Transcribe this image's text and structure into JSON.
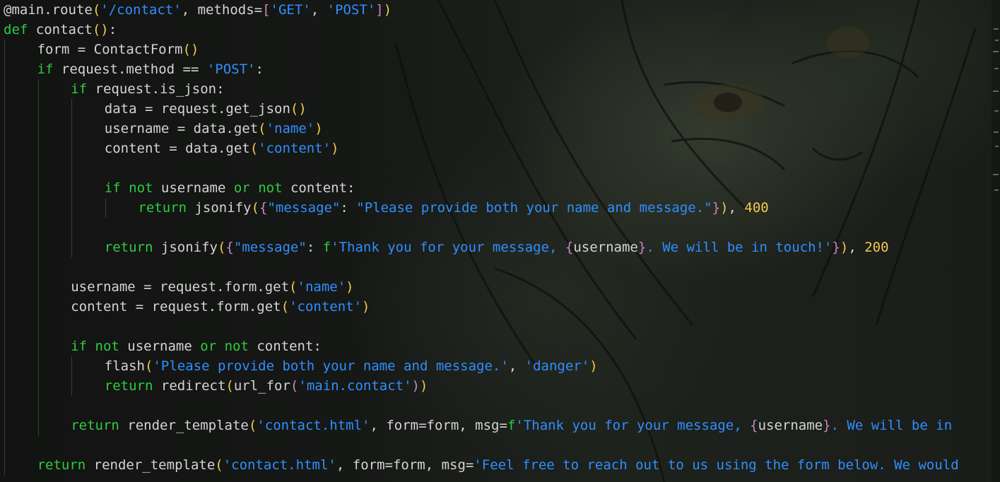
{
  "editor": {
    "language": "python",
    "token_colors": {
      "keyword": "#2ecc40",
      "string": "#2f8fff",
      "number": "#f2c94c",
      "text": "#d4d4d4",
      "bracket_level1": "#f2c94c",
      "bracket_level2": "#c586c0",
      "bracket_level3": "#2f8fff"
    },
    "lines": [
      {
        "indent": 0,
        "tokens": [
          {
            "t": "@main.route",
            "c": "deco"
          },
          {
            "t": "(",
            "c": "p1"
          },
          {
            "t": "'/contact'",
            "c": "str"
          },
          {
            "t": ", methods=",
            "c": ""
          },
          {
            "t": "[",
            "c": "p2"
          },
          {
            "t": "'GET'",
            "c": "str"
          },
          {
            "t": ", ",
            "c": ""
          },
          {
            "t": "'POST'",
            "c": "str"
          },
          {
            "t": "]",
            "c": "p2"
          },
          {
            "t": ")",
            "c": "p1"
          }
        ]
      },
      {
        "indent": 0,
        "tokens": [
          {
            "t": "def",
            "c": "kw"
          },
          {
            "t": " contact",
            "c": ""
          },
          {
            "t": "()",
            "c": "p1"
          },
          {
            "t": ":",
            "c": ""
          }
        ]
      },
      {
        "indent": 1,
        "tokens": [
          {
            "t": "form = ContactForm",
            "c": ""
          },
          {
            "t": "()",
            "c": "p1"
          }
        ]
      },
      {
        "indent": 1,
        "tokens": [
          {
            "t": "if",
            "c": "kw"
          },
          {
            "t": " request.method == ",
            "c": ""
          },
          {
            "t": "'POST'",
            "c": "str"
          },
          {
            "t": ":",
            "c": ""
          }
        ]
      },
      {
        "indent": 2,
        "tokens": [
          {
            "t": "if",
            "c": "kw"
          },
          {
            "t": " request.is_json:",
            "c": ""
          }
        ]
      },
      {
        "indent": 3,
        "tokens": [
          {
            "t": "data = request.get_json",
            "c": ""
          },
          {
            "t": "()",
            "c": "p1"
          }
        ]
      },
      {
        "indent": 3,
        "tokens": [
          {
            "t": "username = data.get",
            "c": ""
          },
          {
            "t": "(",
            "c": "p1"
          },
          {
            "t": "'name'",
            "c": "str"
          },
          {
            "t": ")",
            "c": "p1"
          }
        ]
      },
      {
        "indent": 3,
        "tokens": [
          {
            "t": "content = data.get",
            "c": ""
          },
          {
            "t": "(",
            "c": "p1"
          },
          {
            "t": "'content'",
            "c": "str"
          },
          {
            "t": ")",
            "c": "p1"
          }
        ]
      },
      {
        "indent": 3,
        "tokens": []
      },
      {
        "indent": 3,
        "tokens": [
          {
            "t": "if",
            "c": "kw"
          },
          {
            "t": " ",
            "c": ""
          },
          {
            "t": "not",
            "c": "kw"
          },
          {
            "t": " username ",
            "c": ""
          },
          {
            "t": "or",
            "c": "kw"
          },
          {
            "t": " ",
            "c": ""
          },
          {
            "t": "not",
            "c": "kw"
          },
          {
            "t": " content:",
            "c": ""
          }
        ]
      },
      {
        "indent": 4,
        "tokens": [
          {
            "t": "return",
            "c": "kw"
          },
          {
            "t": " jsonify",
            "c": ""
          },
          {
            "t": "(",
            "c": "p1"
          },
          {
            "t": "{",
            "c": "p2"
          },
          {
            "t": "\"message\"",
            "c": "str"
          },
          {
            "t": ": ",
            "c": ""
          },
          {
            "t": "\"Please provide both your name and message.\"",
            "c": "str"
          },
          {
            "t": "}",
            "c": "p2"
          },
          {
            "t": ")",
            "c": "p1"
          },
          {
            "t": ", ",
            "c": ""
          },
          {
            "t": "400",
            "c": "num"
          }
        ]
      },
      {
        "indent": 3,
        "tokens": []
      },
      {
        "indent": 3,
        "tokens": [
          {
            "t": "return",
            "c": "kw"
          },
          {
            "t": " jsonify",
            "c": ""
          },
          {
            "t": "(",
            "c": "p1"
          },
          {
            "t": "{",
            "c": "p2"
          },
          {
            "t": "\"message\"",
            "c": "str"
          },
          {
            "t": ": ",
            "c": ""
          },
          {
            "t": "f",
            "c": "kw"
          },
          {
            "t": "'Thank you for your message, ",
            "c": "str"
          },
          {
            "t": "{",
            "c": "p2"
          },
          {
            "t": "username",
            "c": ""
          },
          {
            "t": "}",
            "c": "p2"
          },
          {
            "t": ". We will be in touch!'",
            "c": "str"
          },
          {
            "t": "}",
            "c": "p2"
          },
          {
            "t": ")",
            "c": "p1"
          },
          {
            "t": ", ",
            "c": ""
          },
          {
            "t": "200",
            "c": "num"
          }
        ]
      },
      {
        "indent": 2,
        "tokens": []
      },
      {
        "indent": 2,
        "tokens": [
          {
            "t": "username = request.form.get",
            "c": ""
          },
          {
            "t": "(",
            "c": "p1"
          },
          {
            "t": "'name'",
            "c": "str"
          },
          {
            "t": ")",
            "c": "p1"
          }
        ]
      },
      {
        "indent": 2,
        "tokens": [
          {
            "t": "content = request.form.get",
            "c": ""
          },
          {
            "t": "(",
            "c": "p1"
          },
          {
            "t": "'content'",
            "c": "str"
          },
          {
            "t": ")",
            "c": "p1"
          }
        ]
      },
      {
        "indent": 2,
        "tokens": []
      },
      {
        "indent": 2,
        "tokens": [
          {
            "t": "if",
            "c": "kw"
          },
          {
            "t": " ",
            "c": ""
          },
          {
            "t": "not",
            "c": "kw"
          },
          {
            "t": " username ",
            "c": ""
          },
          {
            "t": "or",
            "c": "kw"
          },
          {
            "t": " ",
            "c": ""
          },
          {
            "t": "not",
            "c": "kw"
          },
          {
            "t": " content:",
            "c": ""
          }
        ]
      },
      {
        "indent": 3,
        "tokens": [
          {
            "t": "flash",
            "c": ""
          },
          {
            "t": "(",
            "c": "p1"
          },
          {
            "t": "'Please provide both your name and message.'",
            "c": "str"
          },
          {
            "t": ", ",
            "c": ""
          },
          {
            "t": "'danger'",
            "c": "str"
          },
          {
            "t": ")",
            "c": "p1"
          }
        ]
      },
      {
        "indent": 3,
        "tokens": [
          {
            "t": "return",
            "c": "kw"
          },
          {
            "t": " redirect",
            "c": ""
          },
          {
            "t": "(",
            "c": "p1"
          },
          {
            "t": "url_for",
            "c": ""
          },
          {
            "t": "(",
            "c": "p2"
          },
          {
            "t": "'main.contact'",
            "c": "str"
          },
          {
            "t": ")",
            "c": "p2"
          },
          {
            "t": ")",
            "c": "p1"
          }
        ]
      },
      {
        "indent": 2,
        "tokens": []
      },
      {
        "indent": 2,
        "tokens": [
          {
            "t": "return",
            "c": "kw"
          },
          {
            "t": " render_template",
            "c": ""
          },
          {
            "t": "(",
            "c": "p1"
          },
          {
            "t": "'contact.html'",
            "c": "str"
          },
          {
            "t": ", form=form, msg=",
            "c": ""
          },
          {
            "t": "f",
            "c": "kw"
          },
          {
            "t": "'Thank you for your message, ",
            "c": "str"
          },
          {
            "t": "{",
            "c": "p2"
          },
          {
            "t": "username",
            "c": ""
          },
          {
            "t": "}",
            "c": "p2"
          },
          {
            "t": ". We will be in",
            "c": "str"
          }
        ]
      },
      {
        "indent": 1,
        "tokens": []
      },
      {
        "indent": 1,
        "tokens": [
          {
            "t": "return",
            "c": "kw"
          },
          {
            "t": " render_template",
            "c": ""
          },
          {
            "t": "(",
            "c": "p1"
          },
          {
            "t": "'contact.html'",
            "c": "str"
          },
          {
            "t": ", form=form, msg=",
            "c": ""
          },
          {
            "t": "'Feel free to reach out to us using the form below. We would",
            "c": "str"
          }
        ]
      }
    ]
  }
}
